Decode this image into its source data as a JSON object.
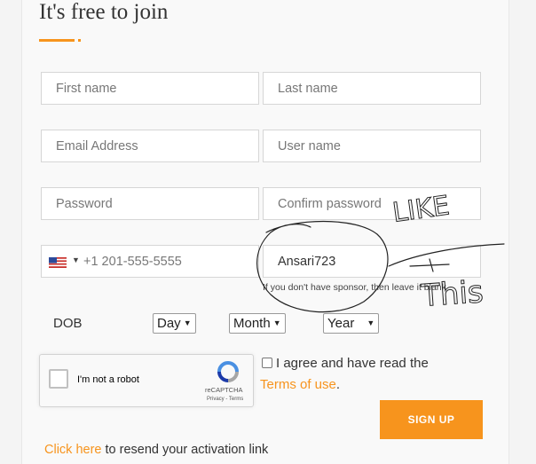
{
  "heading": {
    "title": "It's free to join"
  },
  "form": {
    "first_name": {
      "placeholder": "First name"
    },
    "last_name": {
      "placeholder": "Last name"
    },
    "email": {
      "placeholder": "Email Address"
    },
    "username": {
      "placeholder": "User name"
    },
    "password": {
      "placeholder": "Password"
    },
    "confirm_password": {
      "placeholder": "Confirm password"
    },
    "phone": {
      "placeholder": "+1 201-555-5555",
      "country_flag": "us-flag-icon"
    },
    "sponsor": {
      "value": "Ansari723",
      "note": "If you don't have sponsor, then leave it blank"
    },
    "dob": {
      "label": "DOB",
      "day": "Day",
      "month": "Month",
      "year": "Year"
    }
  },
  "recaptcha": {
    "label": "I'm not a robot",
    "brand": "reCAPTCHA",
    "links": "Privacy - Terms"
  },
  "agree": {
    "text": "I agree and have read the",
    "terms_link": "Terms of use",
    "suffix": "."
  },
  "actions": {
    "signup_label": "SIGN UP"
  },
  "footer": {
    "resend_link": "Click here",
    "resend_text": " to resend your activation link"
  },
  "annotation": {
    "line1": "LIKE",
    "line2": "This"
  },
  "colors": {
    "accent": "#f7941d",
    "border": "#d6d6d6",
    "panel": "#f9f9f9"
  }
}
